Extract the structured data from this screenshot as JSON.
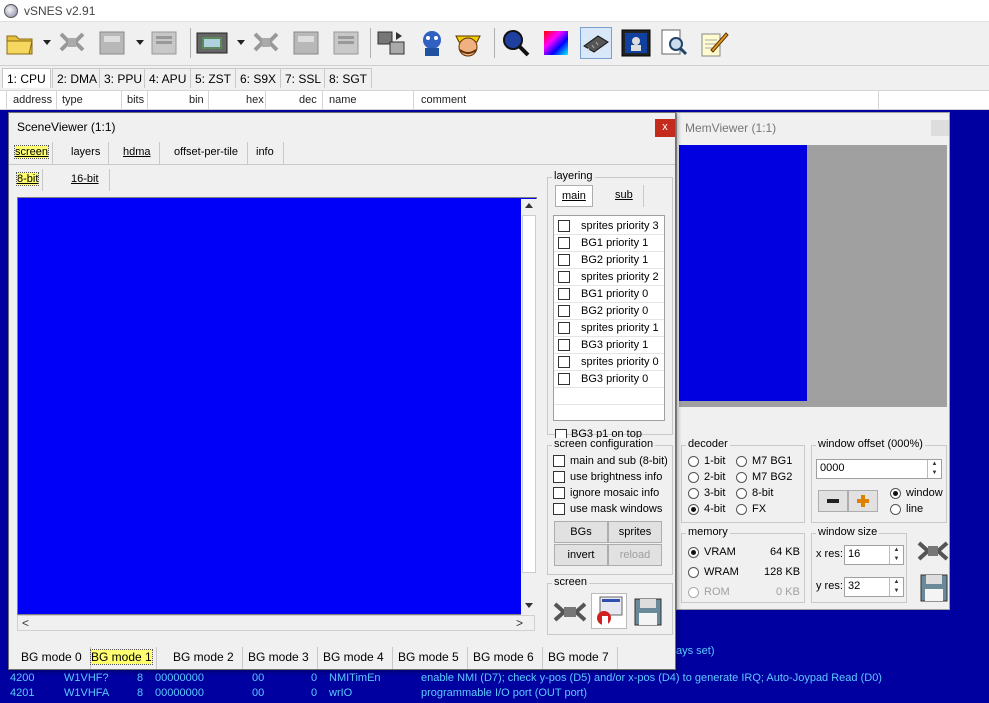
{
  "app": {
    "title": "vSNES v2.91"
  },
  "main_tabs": [
    "1: CPU",
    "2: DMA",
    "3: PPU",
    "4: APU",
    "5: ZST",
    "6: S9X",
    "7: SSL",
    "8: SGT"
  ],
  "columns": [
    "address",
    "type",
    "bits",
    "bin",
    "hex",
    "dec",
    "name",
    "comment"
  ],
  "bottom_rows": [
    {
      "address": "",
      "type": "",
      "bits": "",
      "bin": "",
      "hex": "",
      "dec": "",
      "name": "",
      "comment": "ays set)"
    },
    {
      "address": "4200",
      "type": "W1VHF?",
      "bits": "8",
      "bin": "00000000",
      "hex": "00",
      "dec": "0",
      "name": "NMITimEn",
      "comment": "enable NMI (D7); check y-pos (D5) and/or x-pos (D4) to generate IRQ; Auto-Joypad Read (D0)"
    },
    {
      "address": "4201",
      "type": "W1VHFA",
      "bits": "8",
      "bin": "00000000",
      "hex": "00",
      "dec": "0",
      "name": "wrIO",
      "comment": "programmable I/O port (OUT port)"
    }
  ],
  "scene_viewer": {
    "title": "SceneViewer (1:1)",
    "close": "x",
    "tabs": [
      "screen",
      "layers",
      "hdma",
      "offset-per-tile",
      "info"
    ],
    "bit_tabs": [
      "8-bit",
      "16-bit"
    ],
    "layering": {
      "label": "layering",
      "tabs": [
        "main",
        "sub"
      ],
      "items": [
        "sprites priority 3",
        "BG1 priority 1",
        "BG2 priority 1",
        "sprites priority 2",
        "BG1 priority 0",
        "BG2 priority 0",
        "sprites priority 1",
        "BG3 priority 1",
        "sprites priority 0",
        "BG3 priority 0"
      ],
      "bg3_on_top": "BG3 p1 on top"
    },
    "screen_config": {
      "label": "screen configuration",
      "options": [
        "main and sub (8-bit)",
        "use brightness info",
        "ignore mosaic info",
        "use mask windows"
      ],
      "buttons": [
        "BGs",
        "sprites",
        "invert",
        "reload"
      ]
    },
    "screen_group": {
      "label": "screen"
    },
    "bg_modes": [
      "BG mode 0",
      "BG mode 1",
      "BG mode 2",
      "BG mode 3",
      "BG mode 4",
      "BG mode 5",
      "BG mode 6",
      "BG mode 7"
    ]
  },
  "mem_viewer": {
    "title": "MemViewer (1:1)",
    "decoder": {
      "label": "decoder",
      "options": [
        "1-bit",
        "M7 BG1",
        "2-bit",
        "M7 BG2",
        "3-bit",
        "8-bit",
        "4-bit",
        "FX"
      ]
    },
    "window_offset": {
      "label": "window offset (000%)",
      "value": "0000",
      "radio": [
        "window",
        "line"
      ]
    },
    "memory": {
      "label": "memory",
      "items": [
        {
          "name": "VRAM",
          "size": "64 KB"
        },
        {
          "name": "WRAM",
          "size": "128 KB"
        },
        {
          "name": "ROM",
          "size": "0 KB"
        }
      ]
    },
    "window_size": {
      "label": "window size",
      "x_label": "x res:",
      "x_value": "16",
      "y_label": "y res:",
      "y_value": "32"
    }
  }
}
